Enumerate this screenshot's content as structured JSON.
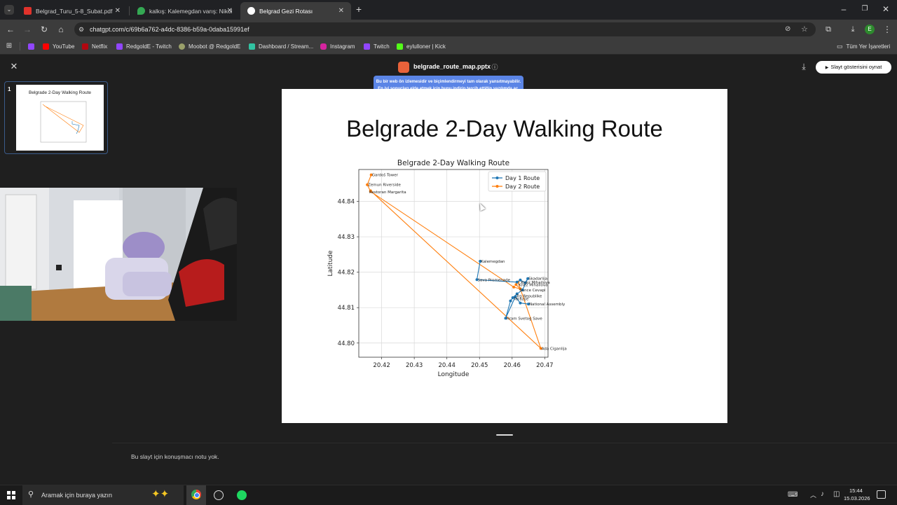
{
  "browser": {
    "tabs": [
      {
        "title": "Belgrad_Turu_5-8_Subat.pdf",
        "active": false,
        "icon": "pdf-icon"
      },
      {
        "title": "kalkış: Kalemegdan varış: Nikola",
        "active": false,
        "icon": "maps-pin-icon"
      },
      {
        "title": "Belgrad Gezi Rotası",
        "active": true,
        "icon": "chatgpt-icon"
      }
    ],
    "url": "chatgpt.com/c/69b6a762-a4dc-8386-b59a-0daba15991ef",
    "bookmarks": [
      "YouTube",
      "Netflix",
      "RedgoldE - Twitch",
      "Moobot @ RedgoldE",
      "Dashboard / Stream...",
      "Instagram",
      "Twitch",
      "eylulloner | Kick"
    ],
    "all_bookmarks": "Tüm Yer İşaretleri",
    "profile_initial": "E"
  },
  "viewer": {
    "file_name": "belgrade_route_map.pptx",
    "slideshow_button": "Slayt gösterisini oynat",
    "tooltip": "Bu bir web ön izlemesidir ve biçimlendirmeyi tam olarak yansıtmayabilir. En iyi sonuçları elde etmek için bunu indirip tercih ettiğin yazılımda aç.",
    "slide_number": "1",
    "thumb_title": "Belgrade 2-Day Walking Route",
    "speaker_notes": "Bu slayt için konuşmacı notu yok."
  },
  "slide": {
    "title": "Belgrade 2-Day Walking Route"
  },
  "chart_data": {
    "type": "line",
    "title": "Belgrade 2-Day Walking Route",
    "xlabel": "Longitude",
    "ylabel": "Latitude",
    "xlim": [
      20.413,
      20.471
    ],
    "ylim": [
      44.796,
      44.849
    ],
    "xticks": [
      "20.42",
      "20.43",
      "20.44",
      "20.45",
      "20.46",
      "20.47"
    ],
    "yticks": [
      "44.80",
      "44.81",
      "44.82",
      "44.83",
      "44.84"
    ],
    "legend": "top-right",
    "grid": true,
    "series": [
      {
        "name": "Day 1 Route",
        "color": "#1f77b4",
        "points": [
          [
            20.4502,
            44.8231
          ],
          [
            20.4492,
            44.8179
          ],
          [
            20.4615,
            44.8172
          ],
          [
            20.4625,
            44.8178
          ],
          [
            20.464,
            44.817
          ],
          [
            20.4648,
            44.8182
          ],
          [
            20.4632,
            44.815
          ],
          [
            20.4615,
            44.8139
          ],
          [
            20.4602,
            44.8128
          ],
          [
            20.4595,
            44.8119
          ],
          [
            20.458,
            44.807
          ],
          [
            20.461,
            44.8131
          ],
          [
            20.4625,
            44.8113
          ],
          [
            20.465,
            44.811
          ]
        ]
      },
      {
        "name": "Day 2 Route",
        "color": "#ff7f0e",
        "points": [
          [
            20.4168,
            44.8475
          ],
          [
            20.4156,
            44.8447
          ],
          [
            20.4166,
            44.8428
          ],
          [
            20.4605,
            44.8158
          ],
          [
            20.4625,
            44.8153
          ],
          [
            20.4612,
            44.8165
          ],
          [
            20.4618,
            44.8172
          ],
          [
            20.4688,
            44.7985
          ],
          [
            20.4166,
            44.843
          ]
        ]
      }
    ],
    "labels": [
      {
        "text": "Gardoš Tower",
        "x": 20.4168,
        "y": 44.8475
      },
      {
        "text": "Zemun Riverside",
        "x": 20.4156,
        "y": 44.8447
      },
      {
        "text": "Restoran Margarita",
        "x": 20.416,
        "y": 44.8427
      },
      {
        "text": "Kalemegdan",
        "x": 20.4502,
        "y": 44.8231
      },
      {
        "text": "Sava Promenade",
        "x": 20.4492,
        "y": 44.8179
      },
      {
        "text": "Skadarlija",
        "x": 20.4648,
        "y": 44.8182
      },
      {
        "text": "Knez Mihailova",
        "x": 20.4625,
        "y": 44.8172
      },
      {
        "text": "Knez Mihailova",
        "x": 20.4618,
        "y": 44.8165
      },
      {
        "text": "Sunce Cevapi",
        "x": 20.462,
        "y": 44.815
      },
      {
        "text": "Trg Republike",
        "x": 20.461,
        "y": 44.8133
      },
      {
        "text": "Terazije",
        "x": 20.4603,
        "y": 44.8125
      },
      {
        "text": "National Assembly",
        "x": 20.465,
        "y": 44.811
      },
      {
        "text": "Hram Svetog Save",
        "x": 20.458,
        "y": 44.807
      },
      {
        "text": "Ada Ciganlija",
        "x": 20.4688,
        "y": 44.7985
      }
    ]
  },
  "taskbar": {
    "search_placeholder": "Aramak için buraya yazın",
    "time": "15:44",
    "date": "15.03.2026"
  }
}
